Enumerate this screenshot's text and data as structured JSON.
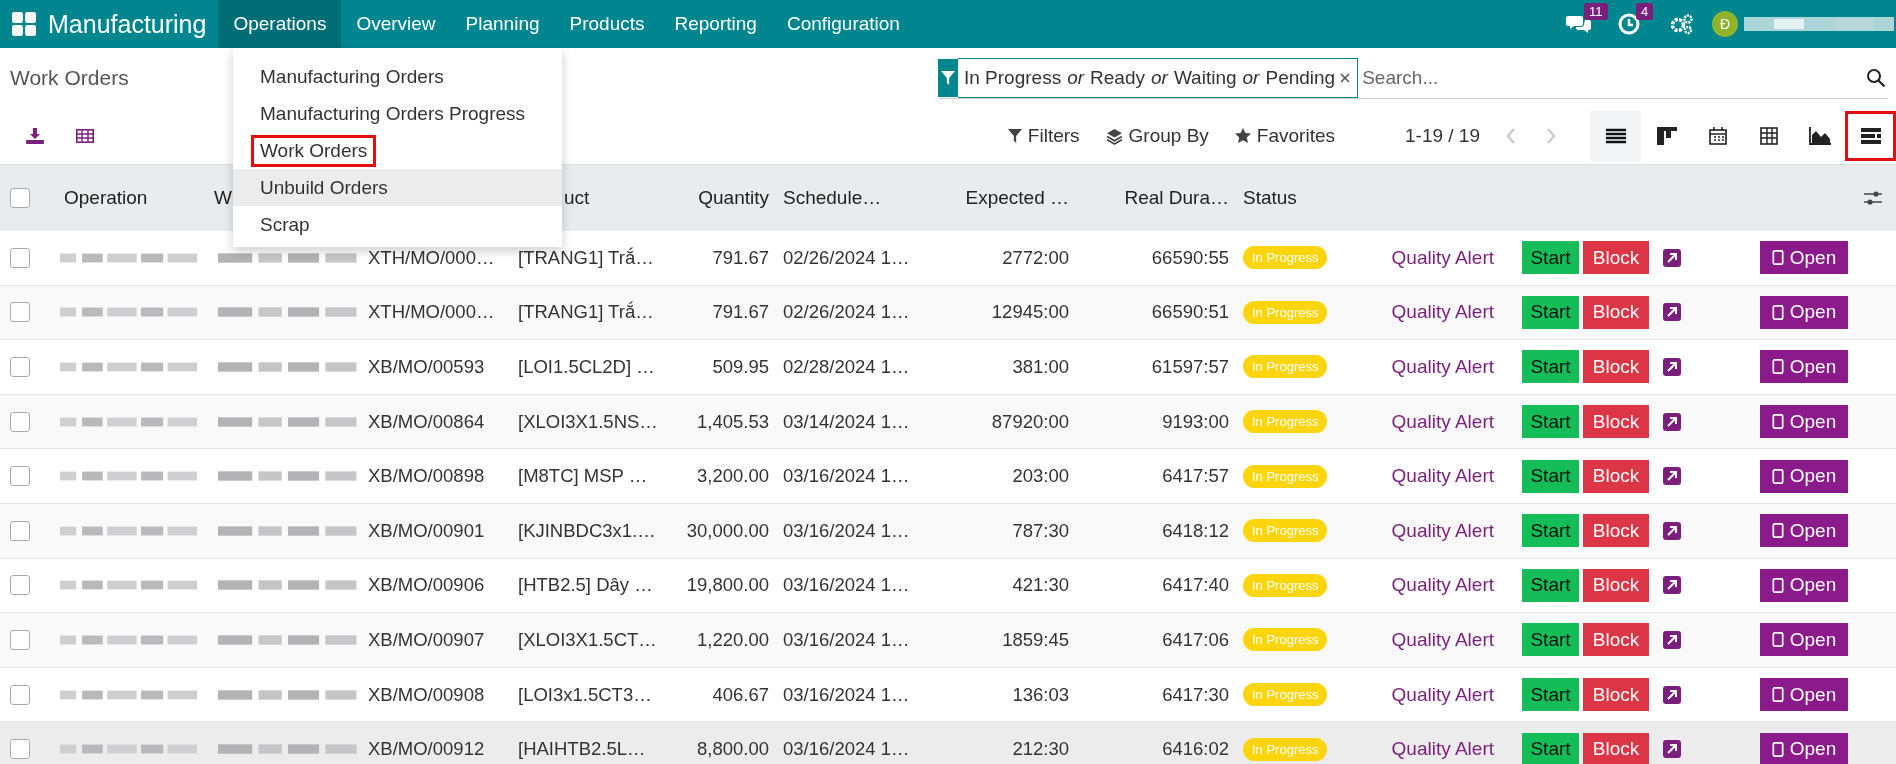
{
  "app": {
    "title": "Manufacturing"
  },
  "nav": [
    {
      "label": "Operations",
      "selected": true
    },
    {
      "label": "Overview",
      "selected": false
    },
    {
      "label": "Planning",
      "selected": false
    },
    {
      "label": "Products",
      "selected": false
    },
    {
      "label": "Reporting",
      "selected": false
    },
    {
      "label": "Configuration",
      "selected": false
    }
  ],
  "systray": {
    "messages_count": "11",
    "activities_count": "4",
    "avatar_initial": "Đ"
  },
  "menu": [
    {
      "label": "Manufacturing Orders",
      "highlighted": false,
      "hovered": false
    },
    {
      "label": "Manufacturing Orders Progress",
      "highlighted": false,
      "hovered": false
    },
    {
      "label": "Work Orders",
      "highlighted": true,
      "hovered": false
    },
    {
      "label": "Unbuild Orders",
      "highlighted": false,
      "hovered": true
    },
    {
      "label": "Scrap",
      "highlighted": false,
      "hovered": false
    }
  ],
  "breadcrumb": "Work Orders",
  "search": {
    "facet": [
      "In Progress",
      "or",
      "Ready",
      "or",
      "Waiting",
      "or",
      "Pending"
    ],
    "placeholder": "Search..."
  },
  "toolbar": {
    "filters": "Filters",
    "group_by": "Group By",
    "favorites": "Favorites",
    "pager": "1-19 / 19"
  },
  "views": [
    {
      "kind": "list",
      "selected": true,
      "highlighted": false
    },
    {
      "kind": "kanban",
      "selected": false,
      "highlighted": false
    },
    {
      "kind": "calendar",
      "selected": false,
      "highlighted": false
    },
    {
      "kind": "pivot",
      "selected": false,
      "highlighted": false
    },
    {
      "kind": "graph",
      "selected": false,
      "highlighted": false
    },
    {
      "kind": "gantt",
      "selected": false,
      "highlighted": true
    }
  ],
  "table": {
    "select_all_checked": false,
    "columns": [
      {
        "label": "Operation"
      },
      {
        "label": "W"
      },
      {
        "label": "uct"
      },
      {
        "label": "Quantity"
      },
      {
        "label": "Schedule…"
      },
      {
        "label": "Expected …"
      },
      {
        "label": "Real Dura…"
      },
      {
        "label": "Status"
      }
    ],
    "rows": [
      {
        "checked": false,
        "mo": "XTH/MO/000…",
        "product": "[TRANG1] Trắ…",
        "quantity": "791.67",
        "scheduled": "02/26/2024 1…",
        "expected": "2772:00",
        "real": "66590:55",
        "status": "In Progress",
        "alert": "Quality Alert",
        "start": "Start",
        "block": "Block",
        "open": "Open",
        "hovered": false
      },
      {
        "checked": false,
        "mo": "XTH/MO/000…",
        "product": "[TRANG1] Trắ…",
        "quantity": "791.67",
        "scheduled": "02/26/2024 1…",
        "expected": "12945:00",
        "real": "66590:51",
        "status": "In Progress",
        "alert": "Quality Alert",
        "start": "Start",
        "block": "Block",
        "open": "Open",
        "hovered": false
      },
      {
        "checked": false,
        "mo": "XB/MO/00593",
        "product": "[LOI1.5CL2D] …",
        "quantity": "509.95",
        "scheduled": "02/28/2024 1…",
        "expected": "381:00",
        "real": "61597:57",
        "status": "In Progress",
        "alert": "Quality Alert",
        "start": "Start",
        "block": "Block",
        "open": "Open",
        "hovered": false
      },
      {
        "checked": false,
        "mo": "XB/MO/00864",
        "product": "[XLOI3X1.5NS…",
        "quantity": "1,405.53",
        "scheduled": "03/14/2024 1…",
        "expected": "87920:00",
        "real": "9193:00",
        "status": "In Progress",
        "alert": "Quality Alert",
        "start": "Start",
        "block": "Block",
        "open": "Open",
        "hovered": false
      },
      {
        "checked": false,
        "mo": "XB/MO/00898",
        "product": "[M8TC] MSP …",
        "quantity": "3,200.00",
        "scheduled": "03/16/2024 1…",
        "expected": "203:00",
        "real": "6417:57",
        "status": "In Progress",
        "alert": "Quality Alert",
        "start": "Start",
        "block": "Block",
        "open": "Open",
        "hovered": false
      },
      {
        "checked": false,
        "mo": "XB/MO/00901",
        "product": "[KJINBDC3x1.…",
        "quantity": "30,000.00",
        "scheduled": "03/16/2024 1…",
        "expected": "787:30",
        "real": "6418:12",
        "status": "In Progress",
        "alert": "Quality Alert",
        "start": "Start",
        "block": "Block",
        "open": "Open",
        "hovered": false
      },
      {
        "checked": false,
        "mo": "XB/MO/00906",
        "product": "[HTB2.5] Dây …",
        "quantity": "19,800.00",
        "scheduled": "03/16/2024 1…",
        "expected": "421:30",
        "real": "6417:40",
        "status": "In Progress",
        "alert": "Quality Alert",
        "start": "Start",
        "block": "Block",
        "open": "Open",
        "hovered": false
      },
      {
        "checked": false,
        "mo": "XB/MO/00907",
        "product": "[XLOI3X1.5CT…",
        "quantity": "1,220.00",
        "scheduled": "03/16/2024 1…",
        "expected": "1859:45",
        "real": "6417:06",
        "status": "In Progress",
        "alert": "Quality Alert",
        "start": "Start",
        "block": "Block",
        "open": "Open",
        "hovered": false
      },
      {
        "checked": false,
        "mo": "XB/MO/00908",
        "product": "[LOI3x1.5CT3…",
        "quantity": "406.67",
        "scheduled": "03/16/2024 1…",
        "expected": "136:03",
        "real": "6417:30",
        "status": "In Progress",
        "alert": "Quality Alert",
        "start": "Start",
        "block": "Block",
        "open": "Open",
        "hovered": false
      },
      {
        "checked": false,
        "mo": "XB/MO/00912",
        "product": "[HAIHTB2.5L…",
        "quantity": "8,800.00",
        "scheduled": "03/16/2024 1…",
        "expected": "212:30",
        "real": "6416:02",
        "status": "In Progress",
        "alert": "Quality Alert",
        "start": "Start",
        "block": "Block",
        "open": "Open",
        "hovered": true
      }
    ]
  }
}
